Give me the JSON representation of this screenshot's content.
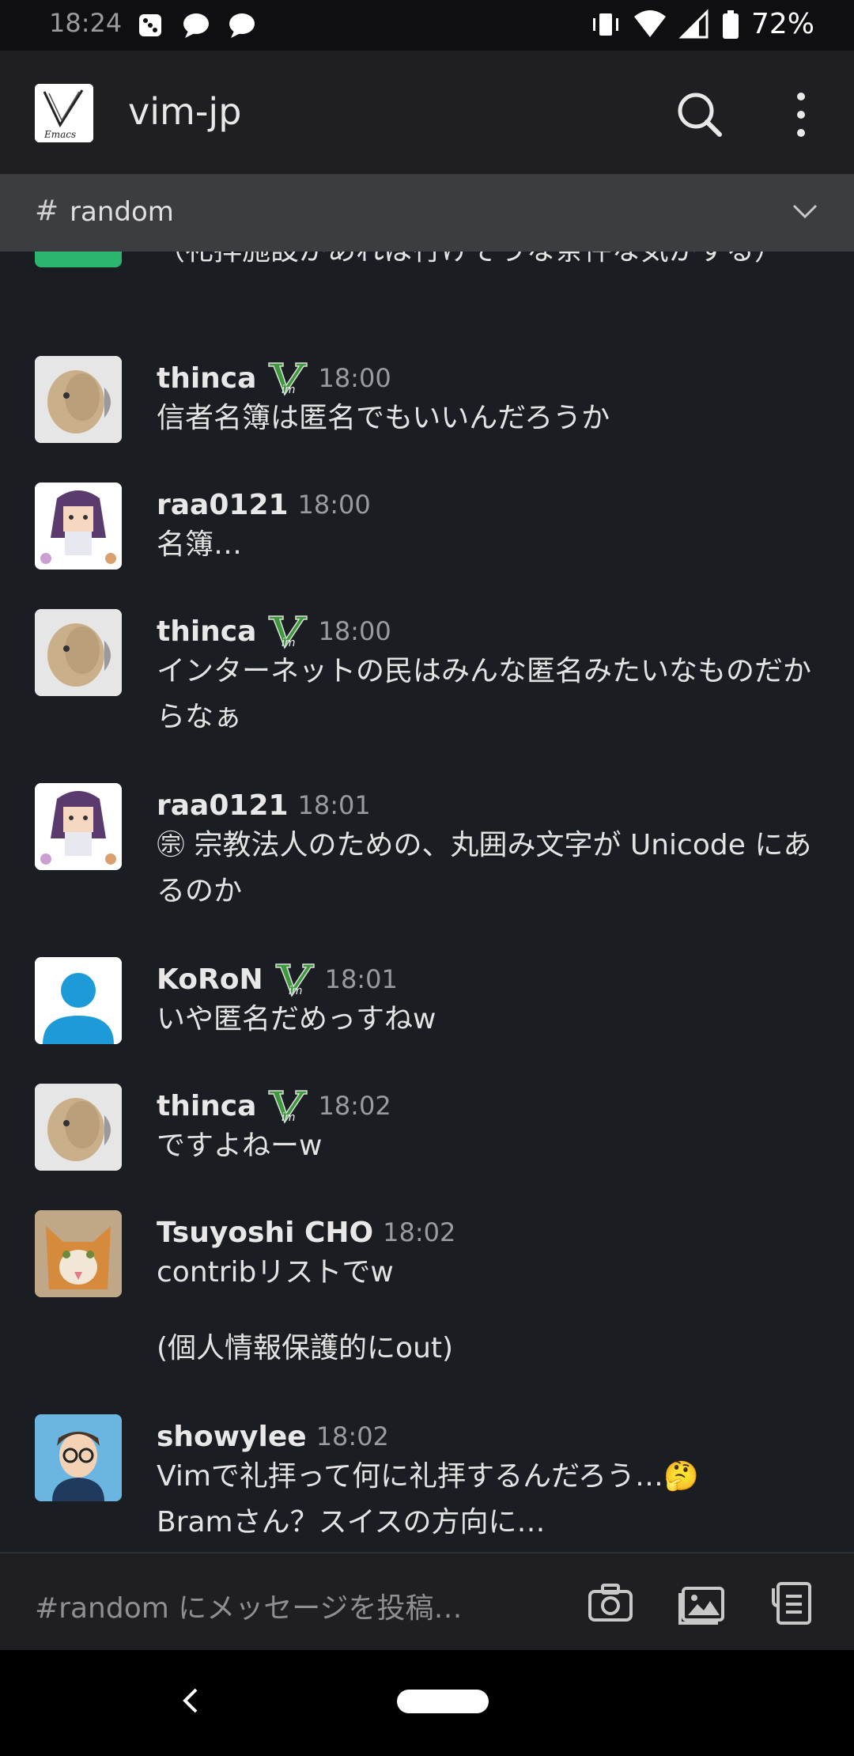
{
  "status_bar": {
    "time": "18:24",
    "battery": "72%",
    "icons": [
      "dice-icon",
      "chat-bubble-icon",
      "chat-bubble-icon",
      "vibrate-icon",
      "wifi-icon",
      "signal-icon",
      "battery-icon"
    ]
  },
  "header": {
    "workspace": "vim-jp",
    "logo_text": "Emacs"
  },
  "channel": {
    "hash": "#",
    "name": "random"
  },
  "messages": {
    "m0": {
      "text": "（礼拝施設があれば行けそうな条件な気がする）"
    },
    "m1": {
      "user": "thinca",
      "time": "18:00",
      "text": "信者名簿は匿名でもいいんだろうか"
    },
    "m2": {
      "user": "raa0121",
      "time": "18:00",
      "text": "名簿…"
    },
    "m3": {
      "user": "thinca",
      "time": "18:00",
      "text": "インターネットの民はみんな匿名みたいなものだからなぁ"
    },
    "m4": {
      "user": "raa0121",
      "time": "18:01",
      "text": "㊪ 宗教法人のための、丸囲み文字が Unicode にあるのか"
    },
    "m5": {
      "user": "KoRoN",
      "time": "18:01",
      "text": "いや匿名だめっすねw"
    },
    "m6": {
      "user": "thinca",
      "time": "18:02",
      "text": "ですよねーw"
    },
    "m7": {
      "user": "Tsuyoshi CHO",
      "time": "18:02",
      "text": "contribリストでw",
      "text2": "(個人情報保護的にout)"
    },
    "m8": {
      "user": "showylee",
      "time": "18:02",
      "text": "Vimで礼拝って何に礼拝するんだろう…🤔",
      "text2": "Bramさん？スイスの方向に…"
    }
  },
  "composer": {
    "placeholder": "#random にメッセージを投稿…"
  },
  "colors": {
    "background": "#1a1d21",
    "header": "#1f1f22",
    "channel_bar": "#3c3d40",
    "vim_green": "#3c9a3c"
  }
}
